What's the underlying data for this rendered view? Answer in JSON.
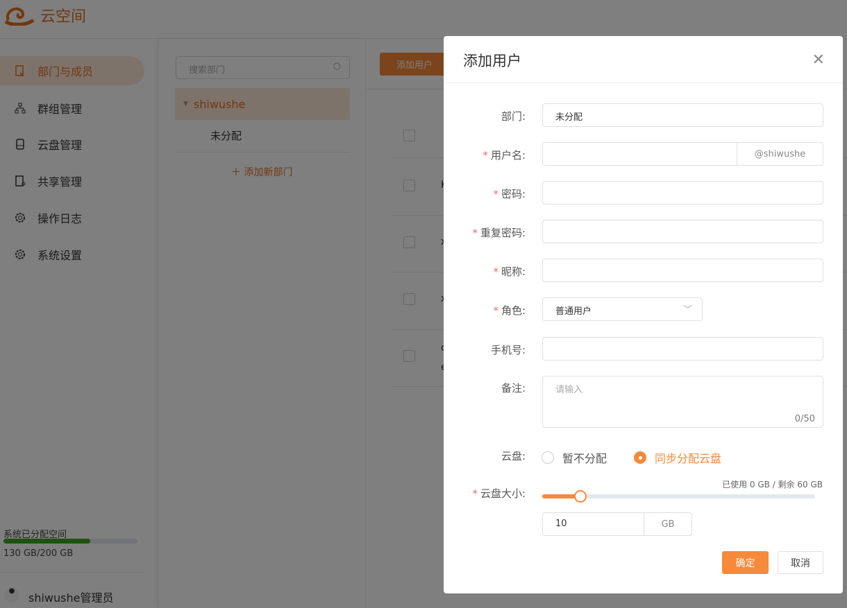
{
  "app": {
    "name": "云空间"
  },
  "sidebar": {
    "items": [
      {
        "label": "部门与成员",
        "active": true
      },
      {
        "label": "群组管理"
      },
      {
        "label": "云盘管理"
      },
      {
        "label": "共享管理"
      },
      {
        "label": "操作日志"
      },
      {
        "label": "系统设置"
      }
    ],
    "storage": {
      "label": "系统已分配空间",
      "used_gb": 130,
      "total_gb": 200,
      "text": "130 GB/200 GB",
      "bar_color": "#3aa51f"
    },
    "user": "shiwushe管理员"
  },
  "dept_panel": {
    "search_placeholder": "搜索部门",
    "root": "shiwushe",
    "children": [
      "未分配"
    ],
    "add_label": "添加新部门"
  },
  "content": {
    "add_user_button": "添加用户",
    "rows": [
      {
        "text": ""
      },
      {
        "text": "K"
      },
      {
        "text": "x"
      },
      {
        "text": "x"
      },
      {
        "text": "c",
        "text2": "e"
      }
    ]
  },
  "modal": {
    "title": "添加用户",
    "fields": {
      "dept_label": "部门:",
      "dept_value": "未分配",
      "username_label": "用户名:",
      "username_suffix": "@shiwushe",
      "password_label": "密码:",
      "repeat_label": "重复密码:",
      "nickname_label": "昵称:",
      "role_label": "角色:",
      "role_value": "普通用户",
      "phone_label": "手机号:",
      "remark_label": "备注:",
      "remark_placeholder": "请输入",
      "remark_count": "0/50",
      "disk_label": "云盘:",
      "disk_options": [
        "暂不分配",
        "同步分配云盘"
      ],
      "disk_selected": 1,
      "size_label": "云盘大小:",
      "size_info": "已使用 0 GB / 剩余 60 GB",
      "size_value": "10",
      "size_unit": "GB",
      "slider_fraction": 0.14
    },
    "confirm": "确定",
    "cancel": "取消"
  },
  "colors": {
    "accent": "#f7893b",
    "required": "#f56c6c"
  }
}
